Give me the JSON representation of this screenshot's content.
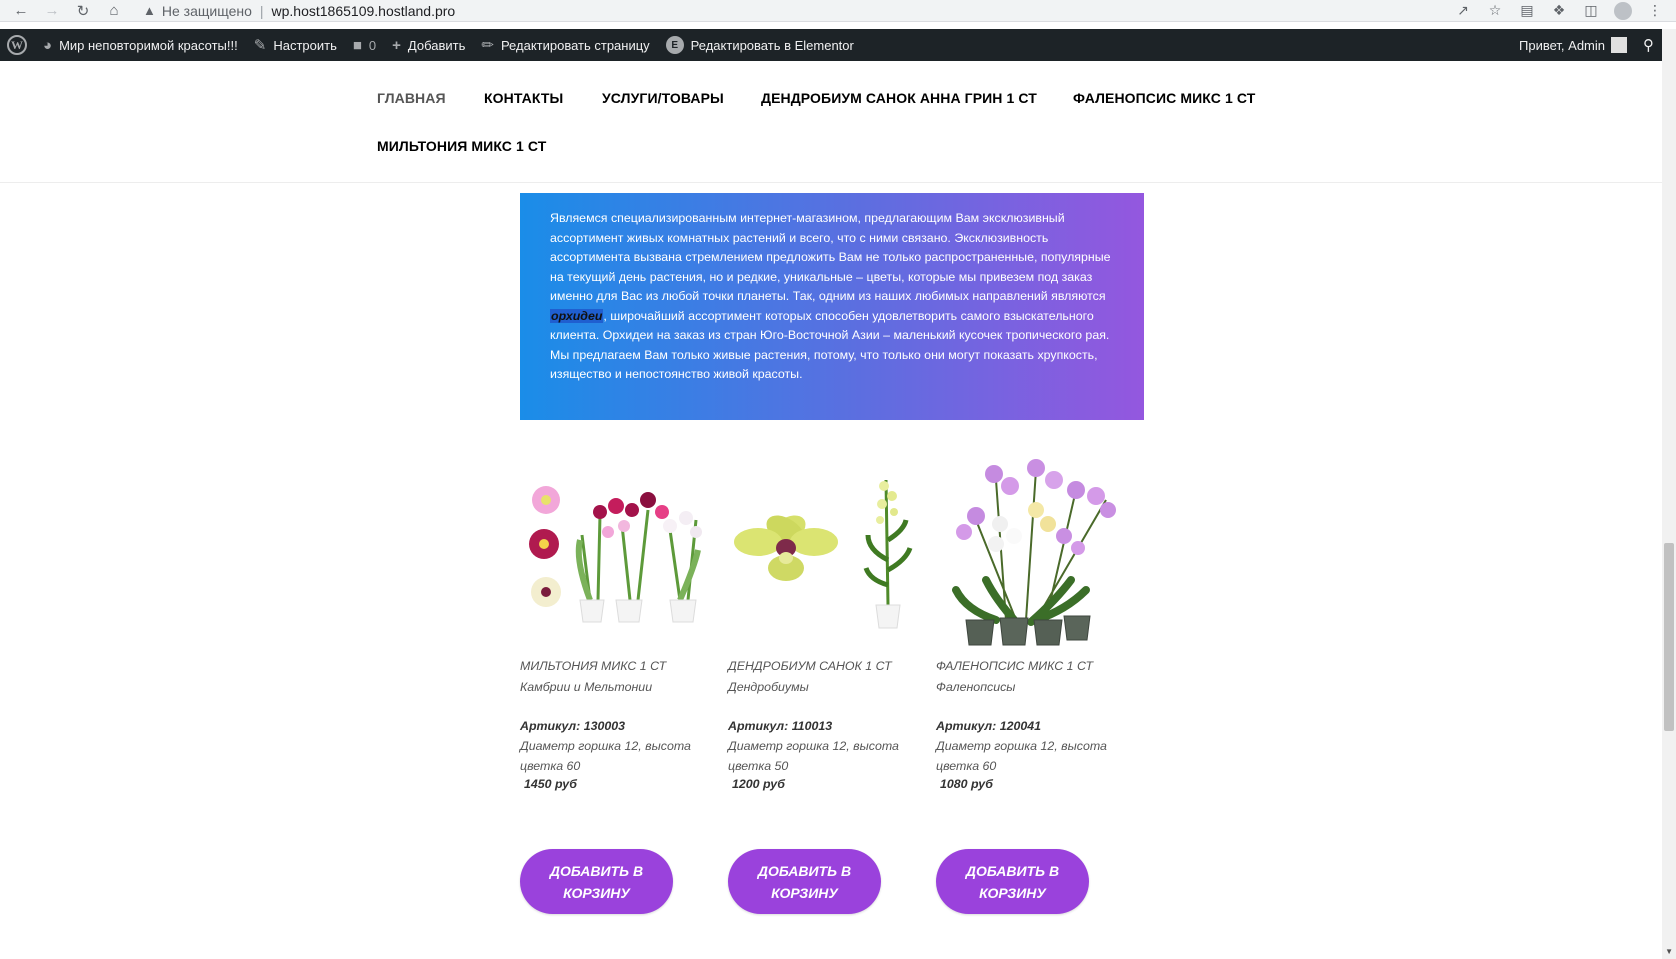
{
  "browser": {
    "security_label": "Не защищено",
    "url": "wp.host1865109.hostland.pro"
  },
  "adminbar": {
    "site_name": "Мир неповторимой красоты!!!",
    "customize": "Настроить",
    "comments_count": "0",
    "add_new": "Добавить",
    "edit_page": "Редактировать страницу",
    "edit_elementor": "Редактировать в Elementor",
    "elementor_badge": "E",
    "greeting": "Привет, Admin"
  },
  "menu": {
    "items": [
      "Главная",
      "Контакты",
      "Услуги/Товары",
      "Дендробиум Санок Анна Грин 1 ст",
      "Фаленопсис микс 1 ст",
      "Мильтония микс 1 ст"
    ]
  },
  "intro": {
    "text_before": "Являемся специализированным интернет-магазином, предлагающим Вам эксклюзивный ассортимент живых комнатных растений и всего, что с ними связано. Эксклюзивность ассортимента вызвана стремлением предложить Вам не только распространенные, популярные на текущий день растения, но и редкие, уникальные – цветы, которые мы привезем под заказ именно для Вас из любой точки планеты. Так, одним из наших любимых направлений являются ",
    "highlight": "орхидеи",
    "text_after": ", широчайший ассортимент которых способен удовлетворить самого взыскательного клиента. Орхидеи на заказ из стран Юго-Восточной Азии – маленький кусочек тропического рая. Мы предлагаем Вам только живые растения, потому, что только они могут показать хрупкость, изящество и непостоянство живой красоты."
  },
  "products": [
    {
      "title": "Мильтония микс 1 ст",
      "category": "Камбрии и Мельтонии",
      "sku": "Артикул: 130003",
      "desc": "Диаметр горшка 12, высота цветка 60",
      "price": "1450 руб",
      "button": "Добавить в корзину"
    },
    {
      "title": "Дендробиум Санок 1 ст",
      "category": "Дендробиумы",
      "sku": "Артикул: 110013",
      "desc": "Диаметр горшка 12, высота цветка 50",
      "price": "1200 руб",
      "button": "Добавить в корзину"
    },
    {
      "title": "Фаленопсис микс 1 ст",
      "category": "Фаленопсисы",
      "sku": "Артикул: 120041",
      "desc": "Диаметр горшка 12, высота цветка 60",
      "price": "1080 руб",
      "button": "Добавить в корзину"
    }
  ],
  "colors": {
    "accent": "#9a42dc",
    "gradient_start": "#1a8de8",
    "gradient_end": "#9457df",
    "adminbar": "#1d2327"
  }
}
